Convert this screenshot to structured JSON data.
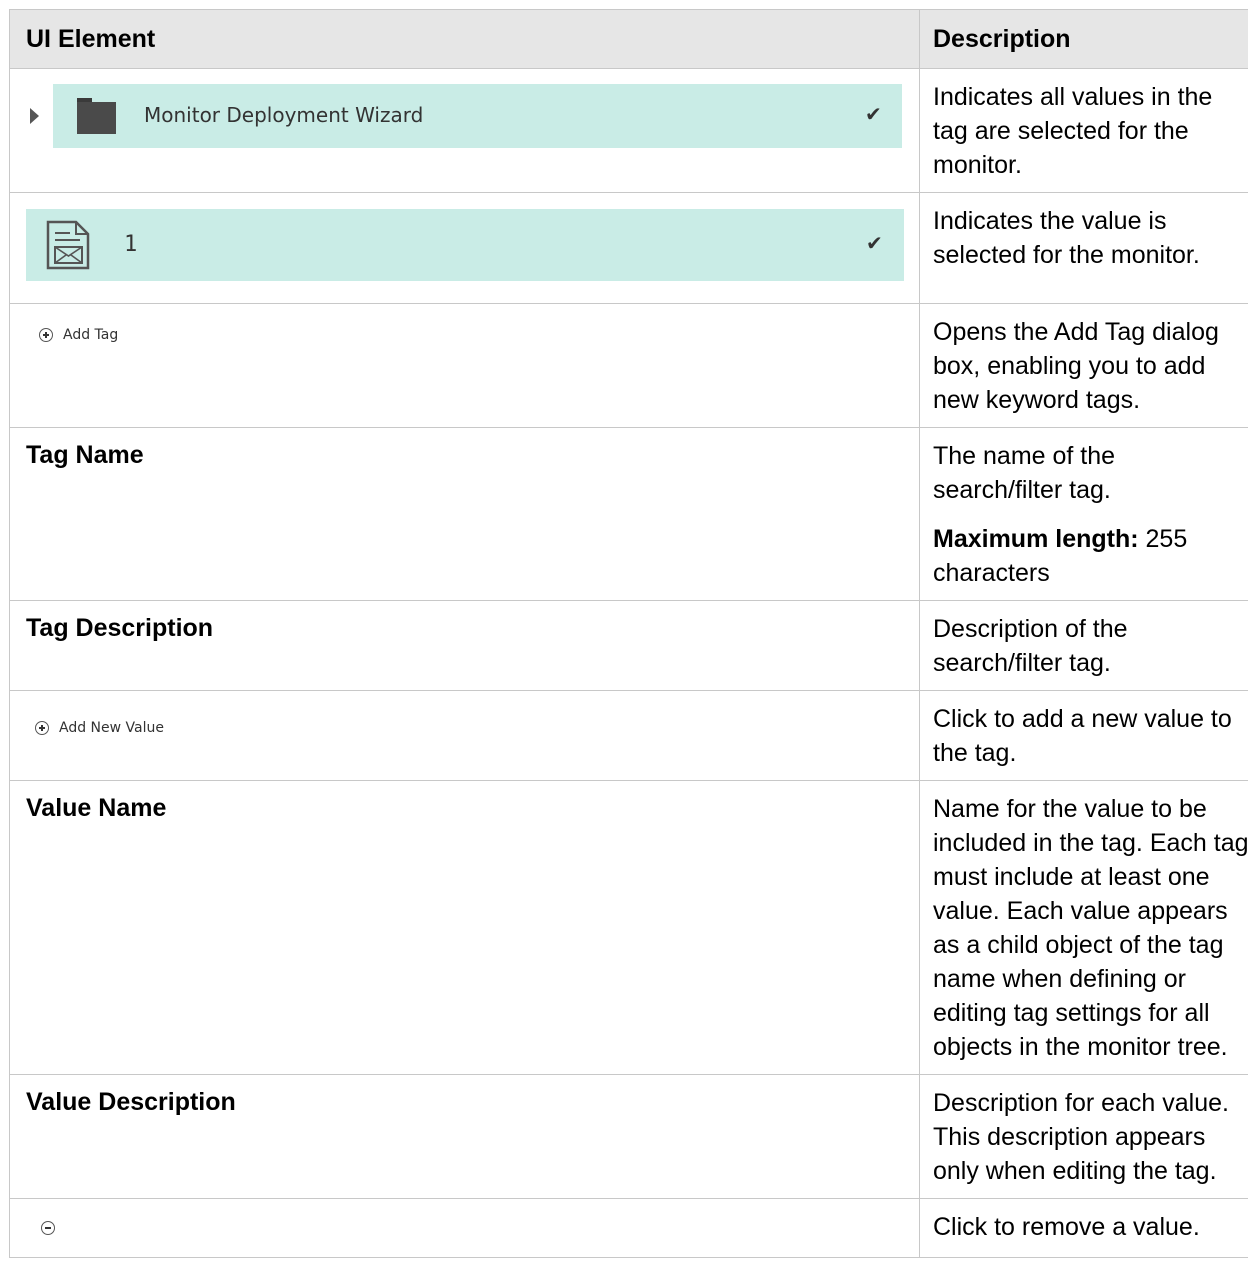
{
  "header": {
    "ui_element": "UI Element",
    "description": "Description"
  },
  "rows": [
    {
      "folder_label": "Monitor Deployment Wizard",
      "description": "Indicates all values in the tag are selected for the monitor.",
      "icon": "folder-icon"
    },
    {
      "value_label": "1",
      "description": "Indicates the value is selected for the monitor.",
      "icon": "value-document-icon"
    },
    {
      "button_label": "Add Tag",
      "description": "Opens the Add Tag dialog box, enabling you to add new keyword tags."
    },
    {
      "label": "Tag Name",
      "description": "The name of the search/filter tag.",
      "note_label": "Maximum length:",
      "note_value": " 255 characters"
    },
    {
      "label": "Tag Description",
      "description": "Description of the search/filter tag."
    },
    {
      "button_label": "Add New Value",
      "description": "Click to add a new value to the tag."
    },
    {
      "label": "Value Name",
      "description": "Name for the value to be included in the tag. Each tag must include at least one value. Each value appears as a child object of the tag name when defining or editing tag settings for all objects in the monitor tree."
    },
    {
      "label": "Value Description",
      "description": "Description for each value. This description appears only when editing the tag."
    },
    {
      "icon": "remove-icon",
      "description": "Click to remove a value."
    }
  ]
}
